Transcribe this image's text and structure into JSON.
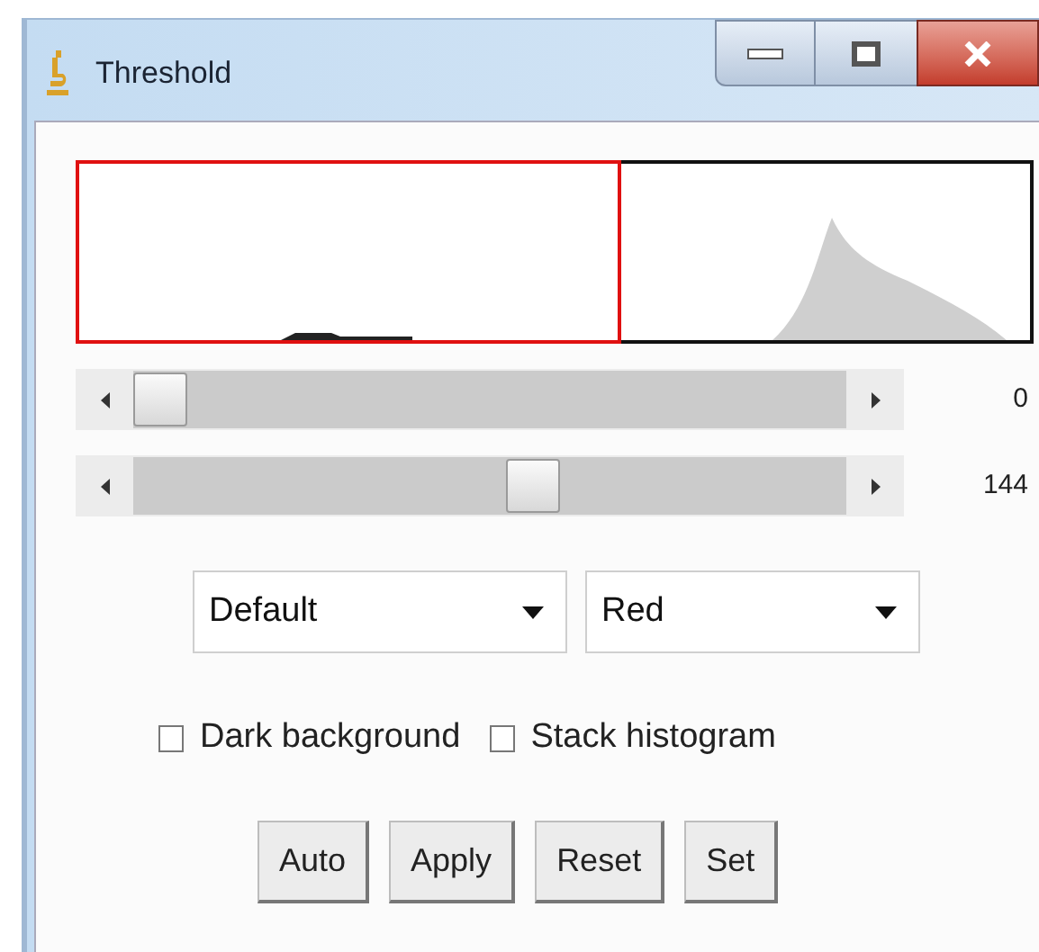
{
  "window": {
    "title": "Threshold"
  },
  "sliders": [
    {
      "level": 0,
      "reading": "0"
    },
    {
      "level": 0.565,
      "reading": "144"
    }
  ],
  "dropdowns": [
    {
      "value": "Default"
    },
    {
      "value": "Red"
    }
  ],
  "checkboxes": [
    {
      "label": "Dark background",
      "checked": false
    },
    {
      "label": "Stack histogram",
      "checked": false
    }
  ],
  "buttons": [
    "Auto",
    "Apply",
    "Reset",
    "Set"
  ]
}
